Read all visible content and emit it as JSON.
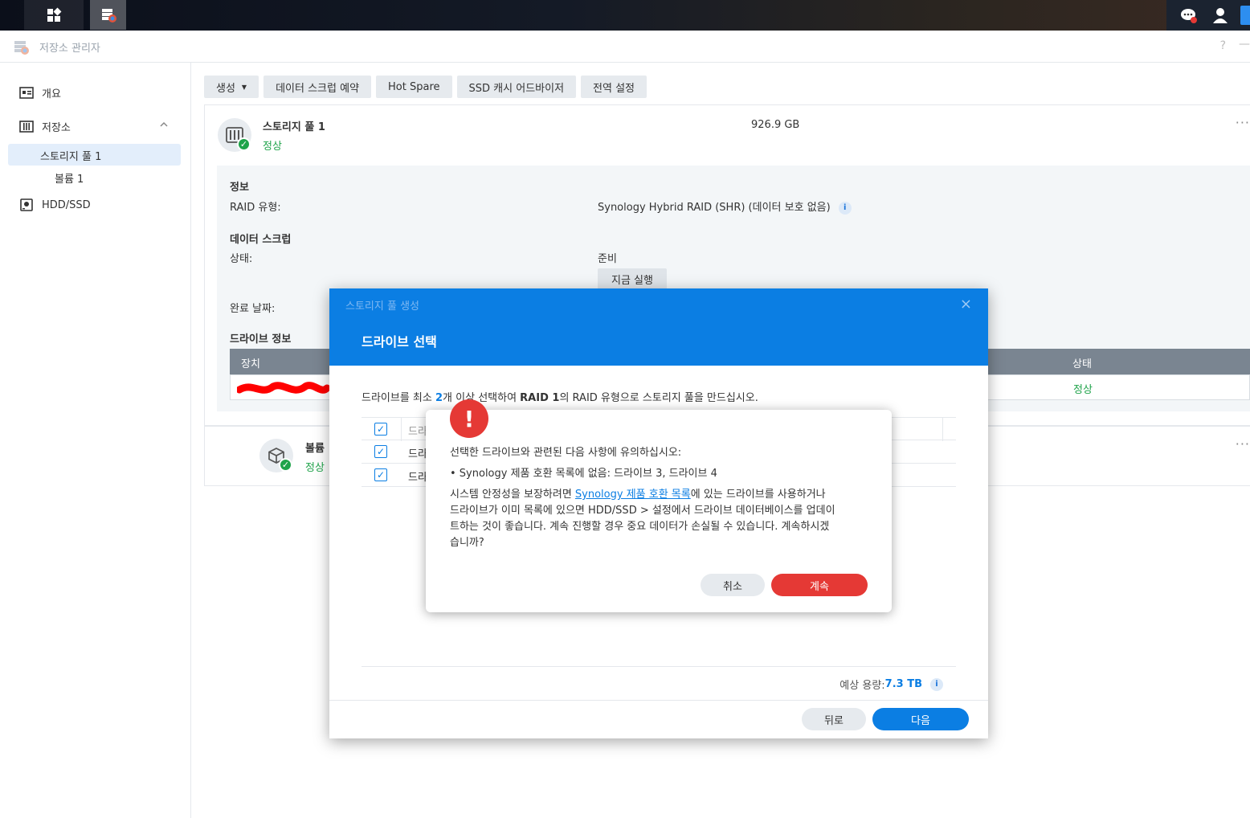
{
  "window": {
    "title": "저장소 관리자",
    "help": "?",
    "minimize": "—"
  },
  "sidebar": {
    "items": [
      {
        "label": "개요"
      },
      {
        "label": "저장소"
      },
      {
        "label": "스토리지 풀 1"
      },
      {
        "label": "볼륨 1"
      },
      {
        "label": "HDD/SSD"
      }
    ]
  },
  "toolbar": {
    "create": "생성",
    "scrub_schedule": "데이터 스크럽 예약",
    "hot_spare": "Hot Spare",
    "ssd_advisor": "SSD 캐시 어드바이저",
    "global_settings": "전역 설정"
  },
  "pool": {
    "name": "스토리지 풀 1",
    "status": "정상",
    "size": "926.9 GB",
    "more": "···",
    "info_heading": "정보",
    "raid_label": "RAID 유형:",
    "raid_value": "Synology Hybrid RAID (SHR) (데이터 보호 없음)",
    "scrub_heading": "데이터 스크럽",
    "state_label": "상태:",
    "state_value": "준비",
    "run_now": "지금 실행",
    "completed_label": "완료 날짜:",
    "drive_info_heading": "드라이브 정보",
    "table_col_device": "장치",
    "table_col_status": "상태",
    "table_row_status": "정상"
  },
  "volume": {
    "name": "볼륨",
    "status": "정상",
    "more": "···"
  },
  "wizard": {
    "subtitle": "스토리지 풀 생성",
    "close": "×",
    "title": "드라이브 선택",
    "desc_a": "드라이브를 최소 ",
    "desc_num": "2",
    "desc_b": "개 이상 선택하여 ",
    "desc_raid": "RAID 1",
    "desc_c": "의 RAID 유형으로 스토리지 풀을 만드십시오.",
    "row_label": "드라",
    "capacity_label": "예상 용량: ",
    "capacity_value": "7.3 TB",
    "back": "뒤로",
    "next": "다음"
  },
  "alert": {
    "icon": "!",
    "line1": "선택한 드라이브와 관련된 다음 사항에 유의하십시오:",
    "bullet": "• Synology 제품 호환 목록에 없음: 드라이브 3, 드라이브 4",
    "p_a": "시스템 안정성을 보장하려면 ",
    "p_link": "Synology 제품 호환 목록",
    "p_b": "에 있는 드라이브를 사용하거나",
    "p_line2": "드라이브가 이미 목록에 있으면 HDD/SSD > 설정에서 드라이브 데이터베이스를 업데이",
    "p_line3": "트하는 것이 좋습니다. 계속 진행할 경우 중요 데이터가 손실될 수 있습니다. 계속하시겠",
    "p_line4": "습니까?",
    "cancel": "취소",
    "continue": "계속"
  },
  "colors": {
    "accent": "#0b7ee3",
    "danger": "#e53935",
    "ok": "#1fa34a"
  }
}
